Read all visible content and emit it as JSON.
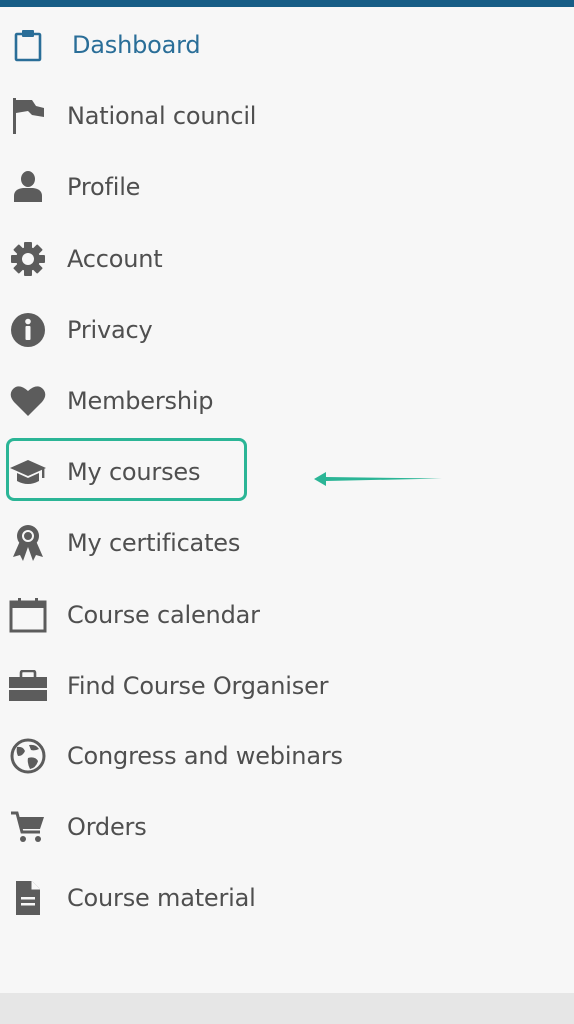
{
  "colors": {
    "accent": "#175d86",
    "active_text": "#2a6e98",
    "text": "#4f4f4f",
    "icon": "#5c5c5c",
    "highlight": "#2bb596"
  },
  "menu": [
    {
      "label": "Dashboard",
      "icon": "clipboard-icon",
      "active": true
    },
    {
      "label": "National council",
      "icon": "flag-icon"
    },
    {
      "label": "Profile",
      "icon": "user-icon"
    },
    {
      "label": "Account",
      "icon": "gear-icon"
    },
    {
      "label": "Privacy",
      "icon": "info-icon"
    },
    {
      "label": "Membership",
      "icon": "heart-icon"
    },
    {
      "label": "My courses",
      "icon": "graduation-cap-icon",
      "highlighted": true
    },
    {
      "label": "My certificates",
      "icon": "award-ribbon-icon"
    },
    {
      "label": "Course calendar",
      "icon": "calendar-icon"
    },
    {
      "label": "Find Course Organiser",
      "icon": "briefcase-icon"
    },
    {
      "label": "Congress and webinars",
      "icon": "globe-icon"
    },
    {
      "label": "Orders",
      "icon": "shopping-cart-icon"
    },
    {
      "label": "Course material",
      "icon": "document-icon"
    }
  ]
}
